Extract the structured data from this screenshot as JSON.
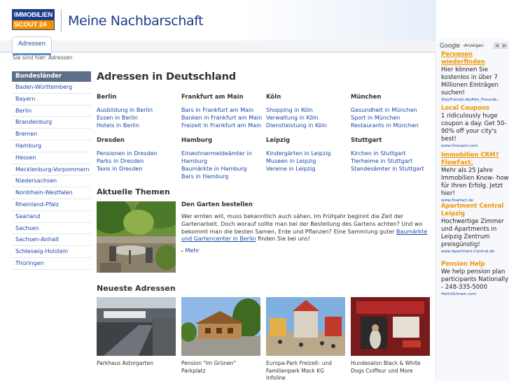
{
  "header": {
    "logo_line1": "IMMOBILIEN",
    "logo_line2": "SCOUT 24",
    "site_title": "Meine Nachbarschaft"
  },
  "tabs": [
    {
      "label": "Adressen",
      "active": true
    }
  ],
  "breadcrumb": "Sie sind hier: Adressen",
  "sidebar": {
    "heading": "Bundesländer",
    "items": [
      "Baden-Württemberg",
      "Bayern",
      "Berlin",
      "Brandenburg",
      "Bremen",
      "Hamburg",
      "Hessen",
      "Mecklenburg-Vorpommern",
      "Niedersachsen",
      "Nordrhein-Westfalen",
      "Rheinland-Pfalz",
      "Saarland",
      "Sachsen",
      "Sachsen-Anhalt",
      "Schleswig-Holstein",
      "Thüringen"
    ]
  },
  "main": {
    "title": "Adressen in Deutschland",
    "cities": [
      {
        "name": "Berlin",
        "links": [
          "Ausbildung in Berlin",
          "Essen in Berlin",
          "Hotels in Berlin"
        ]
      },
      {
        "name": "Frankfurt am Main",
        "links": [
          "Bars in Frankfurt am Main",
          "Banken in Frankfurt am Main",
          "Freizeit in Frankfurt am Main"
        ]
      },
      {
        "name": "Köln",
        "links": [
          "Shopping in Köln",
          "Verwaltung in Köln",
          "Dienstleistung in Köln"
        ]
      },
      {
        "name": "München",
        "links": [
          "Gesundheit in München",
          "Sport in München",
          "Restaurants in München"
        ]
      },
      {
        "name": "Dresden",
        "links": [
          "Pensionen in Dresden",
          "Parks in Dresden",
          "Taxis in Dresden"
        ]
      },
      {
        "name": "Hamburg",
        "links": [
          "Einwohnermeldeämter in Hamburg",
          "Baumärkte in Hamburg",
          "Bars in Hamburg"
        ]
      },
      {
        "name": "Leipzig",
        "links": [
          "Kindergärten in Leipzig",
          "Museen in Leipzig",
          "Vereine in Leipzig"
        ]
      },
      {
        "name": "Stuttgart",
        "links": [
          "Kirchen in Stuttgart",
          "Tierheime in Stuttgart",
          "Standesämter in Stuttgart"
        ]
      }
    ],
    "themes": {
      "title": "Aktuelle Themen",
      "heading": "Den Garten bestellen",
      "text_before": "Wer ernten will, muss bekanntlich auch sähen. Im Frühjahr beginnt die Zeit der Gartenarbeit. Doch worauf sollte man bei der Bestellung des Gartens achten? Und wo bekommt man die besten Samen, Erde und Pflanzen? Eine Sammlung guter ",
      "link_text": "Baumärkte und Gartencenter in Berlin",
      "text_after": " finden Sie bei uns!",
      "more": "Mehr"
    },
    "newest": {
      "title": "Neueste Adressen",
      "items": [
        {
          "caption": "Parkhaus Astorgarten"
        },
        {
          "caption": "Pension \"Im Grünen\" Parkplatz"
        },
        {
          "caption": "Europa-Park Freizeit- und Familienpark Mack KG Infoline"
        },
        {
          "caption": "Hundesalon Black & White Dogs Coiffeur und More"
        }
      ]
    }
  },
  "ads": {
    "brand": "Google",
    "label": "-Anzeigen",
    "items": [
      {
        "title": "Personen wiederfinden",
        "text": "Hier können Sie kostenlos in über 7 Millionen Einträgen suchen!",
        "url": "StayFriends.de/Alte_Freunde..."
      },
      {
        "title": "Local Coupons",
        "text": "1 ridiculously huge coupon a day. Get 50-90% off your city's best!",
        "url": "www.Groupon.com"
      },
      {
        "title": "Immobilien CRM? FlowFact.",
        "text": "Mehr als 25 Jahre Immobilien Know- how für Ihren Erfolg. Jetzt hier!",
        "url": "www.flowfact.de"
      },
      {
        "title": "Apartment Central Leipzig",
        "text": "Hochwertige Zimmer und Apartments in Leipzig Zentrum preisgünstig!",
        "url": "www.Apartment-Central.de"
      },
      {
        "title": "Pension Help",
        "text": "We help pension plan participants Nationally - 248-335-5000",
        "url": "HertzSchram.com"
      }
    ]
  },
  "colors": {
    "brand_blue": "#1d3c8c",
    "brand_orange": "#f29400",
    "link": "#1a47a8",
    "sidebar_head": "#5d6f88"
  }
}
